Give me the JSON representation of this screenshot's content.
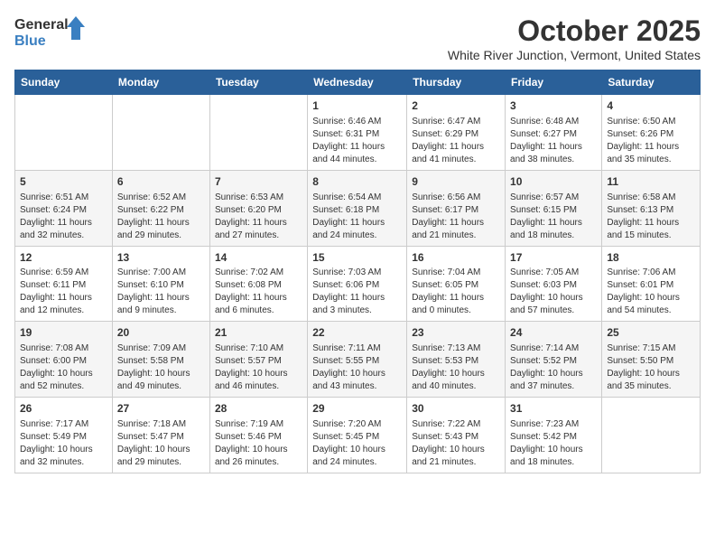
{
  "header": {
    "logo_general": "General",
    "logo_blue": "Blue",
    "title": "October 2025",
    "subtitle": "White River Junction, Vermont, United States"
  },
  "weekdays": [
    "Sunday",
    "Monday",
    "Tuesday",
    "Wednesday",
    "Thursday",
    "Friday",
    "Saturday"
  ],
  "weeks": [
    [
      {
        "day": "",
        "sunrise": "",
        "sunset": "",
        "daylight": ""
      },
      {
        "day": "",
        "sunrise": "",
        "sunset": "",
        "daylight": ""
      },
      {
        "day": "",
        "sunrise": "",
        "sunset": "",
        "daylight": ""
      },
      {
        "day": "1",
        "sunrise": "Sunrise: 6:46 AM",
        "sunset": "Sunset: 6:31 PM",
        "daylight": "Daylight: 11 hours and 44 minutes."
      },
      {
        "day": "2",
        "sunrise": "Sunrise: 6:47 AM",
        "sunset": "Sunset: 6:29 PM",
        "daylight": "Daylight: 11 hours and 41 minutes."
      },
      {
        "day": "3",
        "sunrise": "Sunrise: 6:48 AM",
        "sunset": "Sunset: 6:27 PM",
        "daylight": "Daylight: 11 hours and 38 minutes."
      },
      {
        "day": "4",
        "sunrise": "Sunrise: 6:50 AM",
        "sunset": "Sunset: 6:26 PM",
        "daylight": "Daylight: 11 hours and 35 minutes."
      }
    ],
    [
      {
        "day": "5",
        "sunrise": "Sunrise: 6:51 AM",
        "sunset": "Sunset: 6:24 PM",
        "daylight": "Daylight: 11 hours and 32 minutes."
      },
      {
        "day": "6",
        "sunrise": "Sunrise: 6:52 AM",
        "sunset": "Sunset: 6:22 PM",
        "daylight": "Daylight: 11 hours and 29 minutes."
      },
      {
        "day": "7",
        "sunrise": "Sunrise: 6:53 AM",
        "sunset": "Sunset: 6:20 PM",
        "daylight": "Daylight: 11 hours and 27 minutes."
      },
      {
        "day": "8",
        "sunrise": "Sunrise: 6:54 AM",
        "sunset": "Sunset: 6:18 PM",
        "daylight": "Daylight: 11 hours and 24 minutes."
      },
      {
        "day": "9",
        "sunrise": "Sunrise: 6:56 AM",
        "sunset": "Sunset: 6:17 PM",
        "daylight": "Daylight: 11 hours and 21 minutes."
      },
      {
        "day": "10",
        "sunrise": "Sunrise: 6:57 AM",
        "sunset": "Sunset: 6:15 PM",
        "daylight": "Daylight: 11 hours and 18 minutes."
      },
      {
        "day": "11",
        "sunrise": "Sunrise: 6:58 AM",
        "sunset": "Sunset: 6:13 PM",
        "daylight": "Daylight: 11 hours and 15 minutes."
      }
    ],
    [
      {
        "day": "12",
        "sunrise": "Sunrise: 6:59 AM",
        "sunset": "Sunset: 6:11 PM",
        "daylight": "Daylight: 11 hours and 12 minutes."
      },
      {
        "day": "13",
        "sunrise": "Sunrise: 7:00 AM",
        "sunset": "Sunset: 6:10 PM",
        "daylight": "Daylight: 11 hours and 9 minutes."
      },
      {
        "day": "14",
        "sunrise": "Sunrise: 7:02 AM",
        "sunset": "Sunset: 6:08 PM",
        "daylight": "Daylight: 11 hours and 6 minutes."
      },
      {
        "day": "15",
        "sunrise": "Sunrise: 7:03 AM",
        "sunset": "Sunset: 6:06 PM",
        "daylight": "Daylight: 11 hours and 3 minutes."
      },
      {
        "day": "16",
        "sunrise": "Sunrise: 7:04 AM",
        "sunset": "Sunset: 6:05 PM",
        "daylight": "Daylight: 11 hours and 0 minutes."
      },
      {
        "day": "17",
        "sunrise": "Sunrise: 7:05 AM",
        "sunset": "Sunset: 6:03 PM",
        "daylight": "Daylight: 10 hours and 57 minutes."
      },
      {
        "day": "18",
        "sunrise": "Sunrise: 7:06 AM",
        "sunset": "Sunset: 6:01 PM",
        "daylight": "Daylight: 10 hours and 54 minutes."
      }
    ],
    [
      {
        "day": "19",
        "sunrise": "Sunrise: 7:08 AM",
        "sunset": "Sunset: 6:00 PM",
        "daylight": "Daylight: 10 hours and 52 minutes."
      },
      {
        "day": "20",
        "sunrise": "Sunrise: 7:09 AM",
        "sunset": "Sunset: 5:58 PM",
        "daylight": "Daylight: 10 hours and 49 minutes."
      },
      {
        "day": "21",
        "sunrise": "Sunrise: 7:10 AM",
        "sunset": "Sunset: 5:57 PM",
        "daylight": "Daylight: 10 hours and 46 minutes."
      },
      {
        "day": "22",
        "sunrise": "Sunrise: 7:11 AM",
        "sunset": "Sunset: 5:55 PM",
        "daylight": "Daylight: 10 hours and 43 minutes."
      },
      {
        "day": "23",
        "sunrise": "Sunrise: 7:13 AM",
        "sunset": "Sunset: 5:53 PM",
        "daylight": "Daylight: 10 hours and 40 minutes."
      },
      {
        "day": "24",
        "sunrise": "Sunrise: 7:14 AM",
        "sunset": "Sunset: 5:52 PM",
        "daylight": "Daylight: 10 hours and 37 minutes."
      },
      {
        "day": "25",
        "sunrise": "Sunrise: 7:15 AM",
        "sunset": "Sunset: 5:50 PM",
        "daylight": "Daylight: 10 hours and 35 minutes."
      }
    ],
    [
      {
        "day": "26",
        "sunrise": "Sunrise: 7:17 AM",
        "sunset": "Sunset: 5:49 PM",
        "daylight": "Daylight: 10 hours and 32 minutes."
      },
      {
        "day": "27",
        "sunrise": "Sunrise: 7:18 AM",
        "sunset": "Sunset: 5:47 PM",
        "daylight": "Daylight: 10 hours and 29 minutes."
      },
      {
        "day": "28",
        "sunrise": "Sunrise: 7:19 AM",
        "sunset": "Sunset: 5:46 PM",
        "daylight": "Daylight: 10 hours and 26 minutes."
      },
      {
        "day": "29",
        "sunrise": "Sunrise: 7:20 AM",
        "sunset": "Sunset: 5:45 PM",
        "daylight": "Daylight: 10 hours and 24 minutes."
      },
      {
        "day": "30",
        "sunrise": "Sunrise: 7:22 AM",
        "sunset": "Sunset: 5:43 PM",
        "daylight": "Daylight: 10 hours and 21 minutes."
      },
      {
        "day": "31",
        "sunrise": "Sunrise: 7:23 AM",
        "sunset": "Sunset: 5:42 PM",
        "daylight": "Daylight: 10 hours and 18 minutes."
      },
      {
        "day": "",
        "sunrise": "",
        "sunset": "",
        "daylight": ""
      }
    ]
  ]
}
